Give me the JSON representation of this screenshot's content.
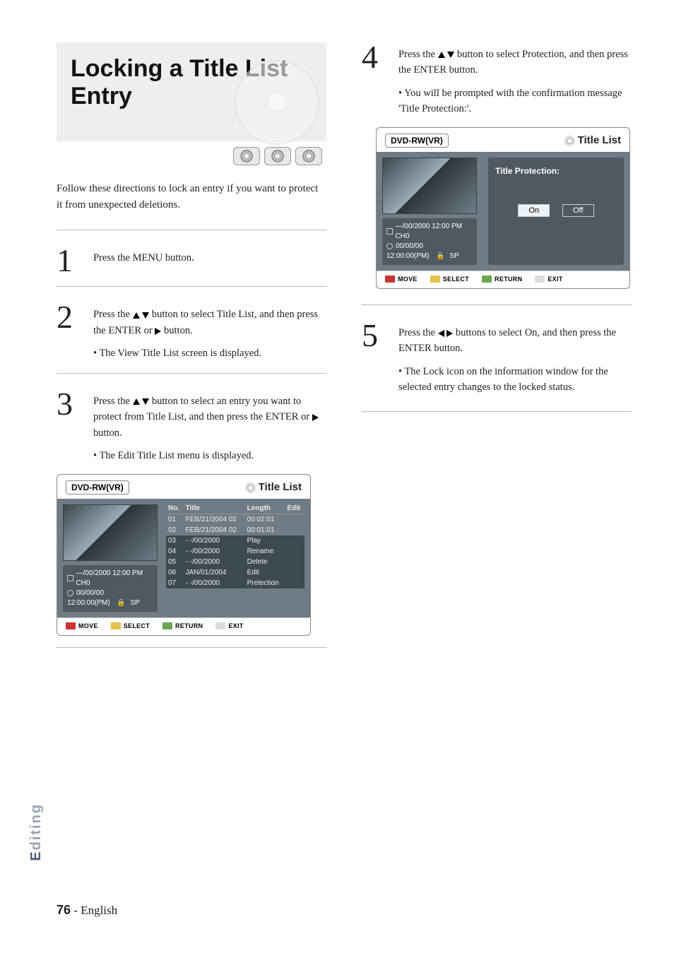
{
  "page": {
    "title": "Locking a Title List Entry",
    "intro": "Follow these directions to lock an entry if you want to protect it from unexpected deletions.",
    "side_tab_prefix": "E",
    "side_tab_rest": "diting",
    "page_number": "76",
    "page_lang": "English"
  },
  "steps": {
    "s1": {
      "num": "1",
      "text": "Press the MENU button."
    },
    "s2": {
      "num": "2",
      "text_a": "Press the ",
      "text_b": " button to select Title List, and then press the ENTER or ",
      "text_c": " button.",
      "bullet": "• The View Title List screen is displayed."
    },
    "s3": {
      "num": "3",
      "text_a": "Press the ",
      "text_b": " button to select an entry you want to protect from Title List, and then press the ENTER or ",
      "text_c": " button.",
      "bullet": "• The Edit Title List menu is displayed."
    },
    "s4": {
      "num": "4",
      "text_a": "Press the ",
      "text_b": " button to select Protection, and then press the ENTER button.",
      "bullet": "• You will be prompted with the confirmation message 'Title Protection:'."
    },
    "s5": {
      "num": "5",
      "text_a": "Press the ",
      "text_b": " buttons to select On, and then press the ENTER button.",
      "bullet": "• The Lock icon on the information window for the selected entry changes to the locked status."
    }
  },
  "osd1": {
    "mode": "DVD-RW(VR)",
    "title": "Title List",
    "info_line1": "—/00/2000 12:00 PM CH0",
    "info_line2": "00/00/00",
    "info_line3_a": "12:00:00(PM)",
    "info_line3_b": "SP",
    "cols": {
      "no": "No.",
      "title": "Title",
      "length": "Length",
      "edit": "Edit"
    },
    "rows": [
      {
        "no": "01",
        "title": "FEB/21/2004 02",
        "length": "00:02:01"
      },
      {
        "no": "02",
        "title": "FEB/21/2004 02",
        "length": "00:01:01"
      },
      {
        "no": "03",
        "title": "- -/00/2000",
        "length": "Play"
      },
      {
        "no": "04",
        "title": "- -/00/2000",
        "length": "Rename"
      },
      {
        "no": "05",
        "title": "- -/00/2000",
        "length": "Delete"
      },
      {
        "no": "06",
        "title": "JAN/01/2004",
        "length": "Edit"
      },
      {
        "no": "07",
        "title": "- -/00/2000",
        "length": "Pretection"
      }
    ],
    "footer": {
      "move": "MOVE",
      "select": "SELECT",
      "return": "RETURN",
      "exit": "EXIT"
    }
  },
  "osd2": {
    "mode": "DVD-RW(VR)",
    "title": "Title List",
    "info_line1": "—/00/2000 12:00 PM CH0",
    "info_line2": "00/00/00",
    "info_line3_a": "12:00:00(PM)",
    "info_line3_b": "SP",
    "prompt": "Title Protection:",
    "on": "On",
    "off": "Off",
    "footer": {
      "move": "MOVE",
      "select": "SELECT",
      "return": "RETURN",
      "exit": "EXIT"
    }
  }
}
